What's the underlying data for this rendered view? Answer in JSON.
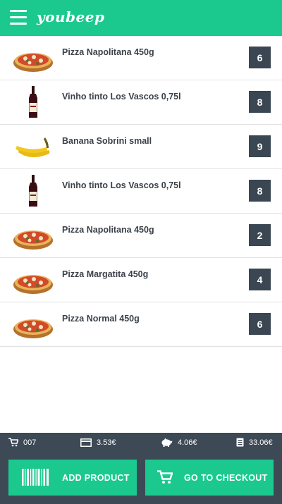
{
  "app": {
    "logo_text": "youbeep"
  },
  "icons": {
    "menu": "hamburger-menu-icon",
    "pizza": "pizza-icon",
    "wine": "wine-bottle-icon",
    "banana": "banana-icon"
  },
  "products": [
    {
      "name": "Pizza Napolitana 450g",
      "qty": "6",
      "icon": "pizza"
    },
    {
      "name": "Vinho tinto Los Vascos 0,75l",
      "qty": "8",
      "icon": "wine"
    },
    {
      "name": "Banana Sobrini small",
      "qty": "9",
      "icon": "banana"
    },
    {
      "name": "Vinho tinto Los Vascos 0,75l",
      "qty": "8",
      "icon": "wine"
    },
    {
      "name": "Pizza Napolitana 450g",
      "qty": "2",
      "icon": "pizza"
    },
    {
      "name": "Pizza Margatita 450g",
      "qty": "4",
      "icon": "pizza"
    },
    {
      "name": "Pizza Normal 450g",
      "qty": "6",
      "icon": "pizza"
    }
  ],
  "summary": {
    "items_count": "007",
    "card_total": "3.53€",
    "savings": "4.06€",
    "receipt_total": "33.06€"
  },
  "actions": {
    "add_product": "ADD PRODUCT",
    "checkout": "GO TO CHECKOUT"
  },
  "colors": {
    "accent": "#1bc98e",
    "dark": "#3d4955",
    "badge": "#3a4652"
  }
}
